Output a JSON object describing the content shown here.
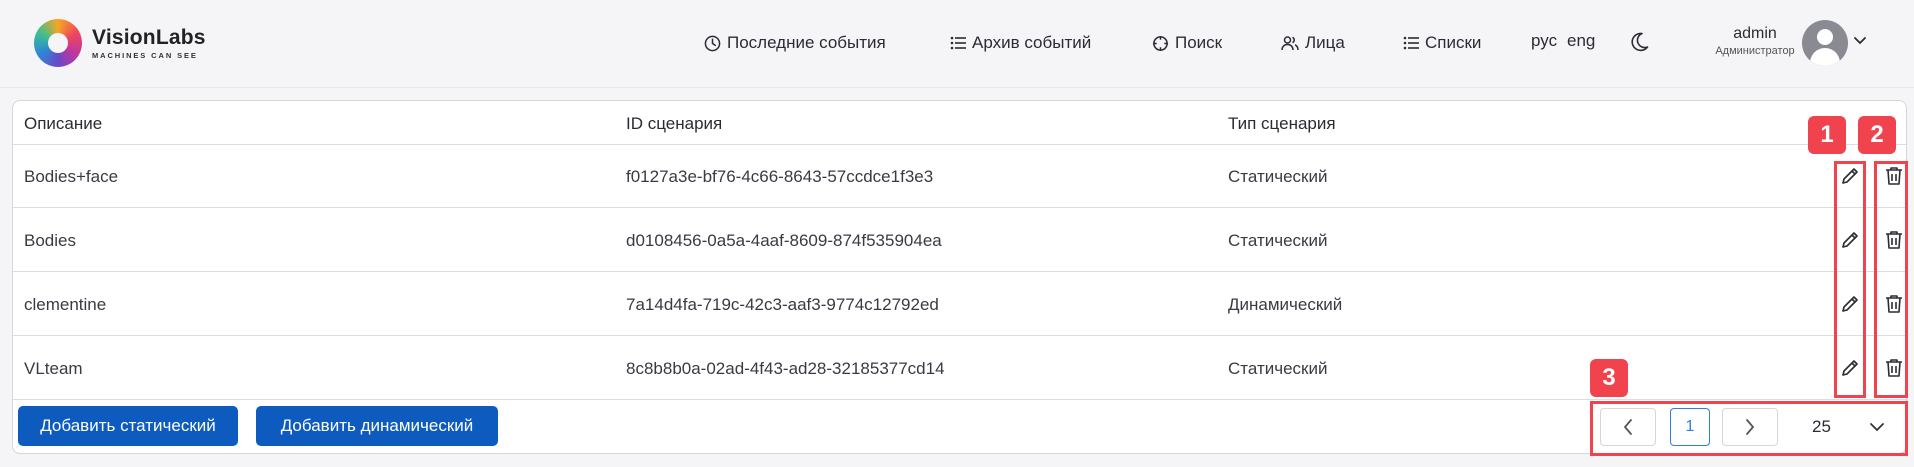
{
  "header": {
    "logo": {
      "name": "VisionLabs",
      "tagline": "MACHINES CAN SEE"
    },
    "nav": [
      {
        "label": "Последние события",
        "icon": "clock-icon"
      },
      {
        "label": "Архив событий",
        "icon": "list-icon"
      },
      {
        "label": "Поиск",
        "icon": "crosshair-icon"
      },
      {
        "label": "Лица",
        "icon": "users-icon"
      },
      {
        "label": "Списки",
        "icon": "list-icon"
      }
    ],
    "languages": [
      "рус",
      "eng"
    ],
    "theme_icon": "moon-icon",
    "user": {
      "name": "admin",
      "role": "Администратор"
    }
  },
  "table": {
    "columns": [
      "Описание",
      "ID сценария",
      "Тип сценария"
    ],
    "rows": [
      {
        "description": "Bodies+face",
        "id": "f0127a3e-bf76-4c66-8643-57ccdce1f3e3",
        "type": "Статический"
      },
      {
        "description": "Bodies",
        "id": "d0108456-0a5a-4aaf-8609-874f535904ea",
        "type": "Статический"
      },
      {
        "description": "clementine",
        "id": "7a14d4fa-719c-42c3-aaf3-9774c12792ed",
        "type": "Динамический"
      },
      {
        "description": "VLteam",
        "id": "8c8b8b0a-02ad-4f43-ad28-32185377cd14",
        "type": "Статический"
      }
    ],
    "row_actions": [
      "pencil-icon",
      "trash-icon"
    ]
  },
  "footer": {
    "add_static": "Добавить статический",
    "add_dynamic": "Добавить динамический",
    "pagination": {
      "current_page": "1",
      "per_page": "25"
    }
  },
  "annotations": [
    "1",
    "2",
    "3"
  ],
  "colors": {
    "accent": "#0d5bbf",
    "annotation": "#f0434d",
    "page_active": "#2f7de1"
  }
}
